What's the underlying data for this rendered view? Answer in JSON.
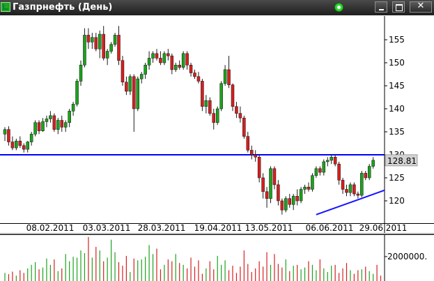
{
  "window": {
    "title": "Газпрнефть (День)",
    "controls": {
      "minimize": "minimize-icon",
      "maximize": "maximize-icon",
      "close": "✕"
    }
  },
  "chart_data": {
    "type": "candlestick",
    "price_axis": {
      "min": 115,
      "max": 160,
      "ticks": [
        120,
        125,
        130,
        135,
        140,
        145,
        150,
        155
      ]
    },
    "current_price": "128.81",
    "date_labels": [
      "08.02.2011",
      "03.03.2011",
      "28.03.2011",
      "19.04.2011",
      "13.05.2011",
      "06.06.2011",
      "29.06.2011"
    ],
    "volume_axis": {
      "label": "2000000."
    },
    "horizontal_line": {
      "price": 130,
      "color": "#0000ff"
    },
    "trend_line": {
      "from": [
        82,
        117
      ],
      "to": [
        109,
        122.3
      ],
      "color": "#1414ff"
    },
    "candle_width_days": 1,
    "up_color": "#1ca21c",
    "down_color": "#d61f1f",
    "candles": [
      {
        "o": 134.5,
        "h": 136.0,
        "l": 133.0,
        "c": 135.5
      },
      {
        "o": 135.5,
        "h": 136.2,
        "l": 132.0,
        "c": 132.8
      },
      {
        "o": 132.8,
        "h": 134.0,
        "l": 131.0,
        "c": 131.5
      },
      {
        "o": 131.5,
        "h": 133.5,
        "l": 131.0,
        "c": 133.0
      },
      {
        "o": 133.0,
        "h": 134.0,
        "l": 131.5,
        "c": 132.0
      },
      {
        "o": 132.0,
        "h": 132.5,
        "l": 130.5,
        "c": 131.2
      },
      {
        "o": 131.2,
        "h": 133.0,
        "l": 130.5,
        "c": 132.8
      },
      {
        "o": 132.8,
        "h": 135.0,
        "l": 132.0,
        "c": 134.5
      },
      {
        "o": 134.5,
        "h": 137.5,
        "l": 134.0,
        "c": 137.0
      },
      {
        "o": 137.0,
        "h": 137.5,
        "l": 134.5,
        "c": 135.2
      },
      {
        "o": 135.2,
        "h": 138.0,
        "l": 135.0,
        "c": 137.2
      },
      {
        "o": 137.2,
        "h": 138.5,
        "l": 136.0,
        "c": 137.8
      },
      {
        "o": 137.8,
        "h": 139.5,
        "l": 137.0,
        "c": 138.5
      },
      {
        "o": 138.5,
        "h": 139.0,
        "l": 135.0,
        "c": 135.5
      },
      {
        "o": 135.5,
        "h": 138.0,
        "l": 134.5,
        "c": 137.5
      },
      {
        "o": 137.5,
        "h": 138.5,
        "l": 135.0,
        "c": 136.0
      },
      {
        "o": 136.0,
        "h": 137.5,
        "l": 135.0,
        "c": 137.0
      },
      {
        "o": 137.0,
        "h": 140.0,
        "l": 136.0,
        "c": 139.5
      },
      {
        "o": 139.5,
        "h": 141.5,
        "l": 138.5,
        "c": 141.0
      },
      {
        "o": 141.0,
        "h": 146.5,
        "l": 140.5,
        "c": 146.0
      },
      {
        "o": 146.0,
        "h": 150.5,
        "l": 145.0,
        "c": 149.5
      },
      {
        "o": 149.5,
        "h": 157.5,
        "l": 149.0,
        "c": 156.0
      },
      {
        "o": 156.0,
        "h": 157.5,
        "l": 153.0,
        "c": 154.5
      },
      {
        "o": 154.5,
        "h": 156.5,
        "l": 153.0,
        "c": 155.5
      },
      {
        "o": 155.5,
        "h": 156.5,
        "l": 152.5,
        "c": 153.0
      },
      {
        "o": 153.0,
        "h": 157.0,
        "l": 151.0,
        "c": 156.2
      },
      {
        "o": 156.2,
        "h": 158.0,
        "l": 150.5,
        "c": 151.0
      },
      {
        "o": 151.0,
        "h": 153.0,
        "l": 149.5,
        "c": 152.5
      },
      {
        "o": 152.5,
        "h": 154.5,
        "l": 152.0,
        "c": 154.0
      },
      {
        "o": 154.0,
        "h": 156.5,
        "l": 153.5,
        "c": 156.0
      },
      {
        "o": 156.0,
        "h": 158.0,
        "l": 149.5,
        "c": 150.5
      },
      {
        "o": 150.5,
        "h": 151.5,
        "l": 145.0,
        "c": 145.8
      },
      {
        "o": 145.8,
        "h": 147.0,
        "l": 143.0,
        "c": 143.8
      },
      {
        "o": 143.8,
        "h": 147.5,
        "l": 143.0,
        "c": 147.0
      },
      {
        "o": 147.0,
        "h": 147.5,
        "l": 135.0,
        "c": 140.0
      },
      {
        "o": 140.0,
        "h": 147.0,
        "l": 139.5,
        "c": 146.5
      },
      {
        "o": 146.5,
        "h": 148.0,
        "l": 145.5,
        "c": 147.5
      },
      {
        "o": 147.5,
        "h": 150.0,
        "l": 146.5,
        "c": 149.5
      },
      {
        "o": 149.5,
        "h": 152.5,
        "l": 148.5,
        "c": 151.0
      },
      {
        "o": 151.0,
        "h": 152.5,
        "l": 150.0,
        "c": 152.0
      },
      {
        "o": 152.0,
        "h": 153.0,
        "l": 150.5,
        "c": 151.0
      },
      {
        "o": 151.0,
        "h": 152.5,
        "l": 149.5,
        "c": 150.0
      },
      {
        "o": 150.0,
        "h": 152.5,
        "l": 149.5,
        "c": 152.0
      },
      {
        "o": 152.0,
        "h": 153.0,
        "l": 150.5,
        "c": 151.5
      },
      {
        "o": 151.5,
        "h": 152.0,
        "l": 147.5,
        "c": 148.5
      },
      {
        "o": 148.5,
        "h": 150.0,
        "l": 148.0,
        "c": 149.5
      },
      {
        "o": 149.5,
        "h": 150.5,
        "l": 148.5,
        "c": 149.0
      },
      {
        "o": 149.0,
        "h": 152.5,
        "l": 148.5,
        "c": 152.0
      },
      {
        "o": 152.0,
        "h": 152.5,
        "l": 148.5,
        "c": 149.5
      },
      {
        "o": 149.5,
        "h": 150.0,
        "l": 147.0,
        "c": 147.8
      },
      {
        "o": 147.8,
        "h": 148.5,
        "l": 146.5,
        "c": 147.0
      },
      {
        "o": 147.0,
        "h": 148.0,
        "l": 145.5,
        "c": 146.0
      },
      {
        "o": 146.0,
        "h": 146.5,
        "l": 139.5,
        "c": 140.5
      },
      {
        "o": 140.5,
        "h": 143.0,
        "l": 139.0,
        "c": 141.8
      },
      {
        "o": 141.8,
        "h": 142.5,
        "l": 138.5,
        "c": 139.0
      },
      {
        "o": 139.0,
        "h": 140.0,
        "l": 135.5,
        "c": 137.0
      },
      {
        "o": 137.0,
        "h": 140.5,
        "l": 136.5,
        "c": 140.0
      },
      {
        "o": 140.0,
        "h": 146.0,
        "l": 139.5,
        "c": 145.5
      },
      {
        "o": 145.5,
        "h": 149.5,
        "l": 145.0,
        "c": 148.5
      },
      {
        "o": 148.5,
        "h": 151.5,
        "l": 144.5,
        "c": 145.2
      },
      {
        "o": 145.2,
        "h": 145.5,
        "l": 139.5,
        "c": 140.5
      },
      {
        "o": 140.5,
        "h": 141.5,
        "l": 138.0,
        "c": 139.0
      },
      {
        "o": 139.0,
        "h": 140.5,
        "l": 137.0,
        "c": 138.0
      },
      {
        "o": 138.0,
        "h": 138.5,
        "l": 133.5,
        "c": 134.0
      },
      {
        "o": 134.0,
        "h": 135.0,
        "l": 130.5,
        "c": 131.0
      },
      {
        "o": 131.0,
        "h": 132.0,
        "l": 129.0,
        "c": 130.0
      },
      {
        "o": 130.0,
        "h": 131.0,
        "l": 128.5,
        "c": 129.5
      },
      {
        "o": 129.5,
        "h": 130.0,
        "l": 124.0,
        "c": 125.0
      },
      {
        "o": 125.0,
        "h": 126.0,
        "l": 120.5,
        "c": 122.0
      },
      {
        "o": 122.0,
        "h": 123.0,
        "l": 118.5,
        "c": 120.5
      },
      {
        "o": 120.5,
        "h": 127.5,
        "l": 119.5,
        "c": 127.0
      },
      {
        "o": 127.0,
        "h": 127.5,
        "l": 122.5,
        "c": 123.5
      },
      {
        "o": 123.5,
        "h": 124.5,
        "l": 119.0,
        "c": 120.0
      },
      {
        "o": 120.0,
        "h": 120.5,
        "l": 117.0,
        "c": 118.0
      },
      {
        "o": 118.0,
        "h": 121.0,
        "l": 117.5,
        "c": 120.5
      },
      {
        "o": 120.5,
        "h": 121.5,
        "l": 118.5,
        "c": 119.2
      },
      {
        "o": 119.2,
        "h": 121.5,
        "l": 118.0,
        "c": 121.0
      },
      {
        "o": 121.0,
        "h": 122.5,
        "l": 119.0,
        "c": 120.0
      },
      {
        "o": 120.0,
        "h": 123.0,
        "l": 119.5,
        "c": 122.5
      },
      {
        "o": 122.5,
        "h": 123.5,
        "l": 121.5,
        "c": 123.0
      },
      {
        "o": 123.0,
        "h": 124.0,
        "l": 122.0,
        "c": 122.5
      },
      {
        "o": 122.5,
        "h": 126.0,
        "l": 122.0,
        "c": 125.5
      },
      {
        "o": 125.5,
        "h": 127.5,
        "l": 125.0,
        "c": 127.0
      },
      {
        "o": 127.0,
        "h": 127.5,
        "l": 125.5,
        "c": 126.2
      },
      {
        "o": 126.2,
        "h": 129.0,
        "l": 125.5,
        "c": 128.5
      },
      {
        "o": 128.5,
        "h": 129.5,
        "l": 127.5,
        "c": 128.8
      },
      {
        "o": 128.8,
        "h": 130.0,
        "l": 128.0,
        "c": 129.5
      },
      {
        "o": 129.5,
        "h": 130.0,
        "l": 127.5,
        "c": 128.0
      },
      {
        "o": 128.0,
        "h": 128.5,
        "l": 123.5,
        "c": 124.5
      },
      {
        "o": 124.5,
        "h": 125.0,
        "l": 121.5,
        "c": 122.5
      },
      {
        "o": 122.5,
        "h": 123.5,
        "l": 121.0,
        "c": 121.8
      },
      {
        "o": 121.8,
        "h": 124.0,
        "l": 121.0,
        "c": 123.5
      },
      {
        "o": 123.5,
        "h": 124.0,
        "l": 121.0,
        "c": 121.5
      },
      {
        "o": 121.5,
        "h": 122.0,
        "l": 120.5,
        "c": 121.2
      },
      {
        "o": 121.2,
        "h": 126.5,
        "l": 120.8,
        "c": 126.0
      },
      {
        "o": 126.0,
        "h": 126.5,
        "l": 124.5,
        "c": 125.0
      },
      {
        "o": 125.0,
        "h": 128.0,
        "l": 124.5,
        "c": 127.5
      },
      {
        "o": 127.5,
        "h": 129.5,
        "l": 127.0,
        "c": 128.81
      }
    ],
    "volumes": [
      450000,
      380000,
      520000,
      300000,
      600000,
      450000,
      700000,
      900000,
      1050000,
      650000,
      750000,
      1250000,
      900000,
      1200000,
      550000,
      700000,
      1500000,
      1100000,
      1350000,
      1300000,
      1700000,
      1550000,
      2450000,
      1300000,
      1900000,
      1700000,
      1100000,
      1300000,
      2300000,
      1600000,
      1050000,
      850000,
      1400000,
      500000,
      1250000,
      1150000,
      1200000,
      1350000,
      2000000,
      1500000,
      1800000,
      650000,
      900000,
      1200000,
      1100000,
      1500000,
      1000000,
      900000,
      700000,
      1300000,
      800000,
      1150000,
      400000,
      700000,
      1100000,
      650000,
      1400000,
      900000,
      1150000,
      600000,
      850000,
      450000,
      800000,
      1700000,
      950000,
      500000,
      700000,
      1100000,
      800000,
      1600000,
      900000,
      1500000,
      950000,
      750000,
      1200000,
      550000,
      850000,
      900000,
      650000,
      750000,
      1100000,
      900000,
      600000,
      1200000,
      700000,
      500000,
      850000,
      900000,
      450000,
      700000,
      1000000,
      600000,
      400000,
      600000,
      650000,
      800000,
      550000,
      400000,
      900000,
      300000
    ]
  }
}
